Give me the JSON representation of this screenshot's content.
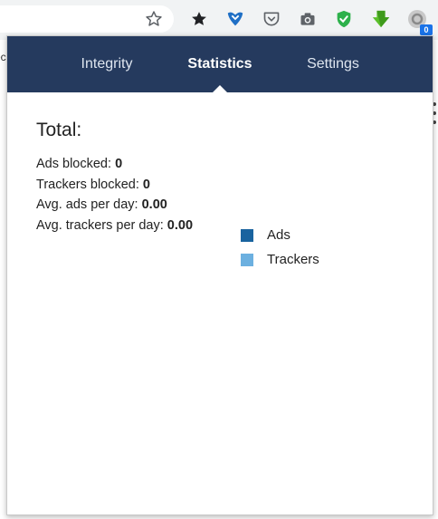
{
  "popup": {
    "tabs": [
      {
        "label": "Integrity",
        "active": false
      },
      {
        "label": "Statistics",
        "active": true
      },
      {
        "label": "Settings",
        "active": false
      }
    ],
    "total_title": "Total:",
    "stats": [
      {
        "label": "Ads blocked:",
        "value": "0"
      },
      {
        "label": "Trackers blocked:",
        "value": "0"
      },
      {
        "label": "Avg. ads per day:",
        "value": "0.00"
      },
      {
        "label": "Avg. trackers per day:",
        "value": "0.00"
      }
    ],
    "legend": [
      {
        "label": "Ads",
        "color": "#19639f"
      },
      {
        "label": "Trackers",
        "color": "#6cb0e0"
      }
    ]
  },
  "toolbar": {
    "icons": [
      "star-outline-icon",
      "star-filled-icon",
      "heart-shield-icon",
      "pocket-icon",
      "camera-icon",
      "green-shield-check-icon",
      "green-download-arrow-icon",
      "extension-icon"
    ],
    "extension_badge": "0"
  },
  "colors": {
    "header": "#253a5e",
    "ads": "#19639f",
    "trackers": "#6cb0e0"
  },
  "page_fragment_text": "ec"
}
